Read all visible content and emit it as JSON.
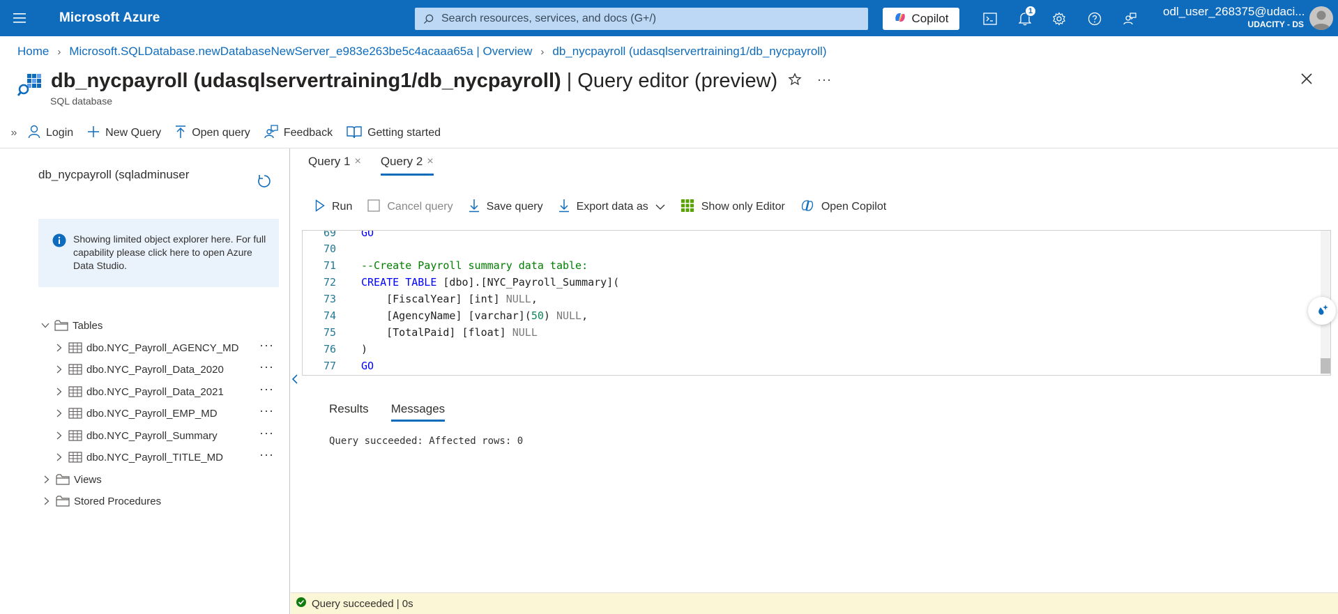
{
  "topbar": {
    "brand": "Microsoft Azure",
    "search_placeholder": "Search resources, services, and docs (G+/)",
    "copilot_label": "Copilot",
    "notification_count": "1",
    "account_name": "odl_user_268375@udaci...",
    "account_directory": "UDACITY - DS"
  },
  "breadcrumb": {
    "items": [
      "Home",
      "Microsoft.SQLDatabase.newDatabaseNewServer_e983e263be5c4acaaa65a | Overview",
      "db_nycpayroll (udasqlservertraining1/db_nycpayroll)"
    ]
  },
  "page": {
    "title_bold": "db_nycpayroll (udasqlservertraining1/db_nycpayroll)",
    "title_rest": " | Query editor (preview)",
    "subtitle": "SQL database"
  },
  "commands": {
    "login": "Login",
    "new_query": "New Query",
    "open_query": "Open query",
    "feedback": "Feedback",
    "getting_started": "Getting started"
  },
  "explorer": {
    "db_label": "db_nycpayroll (sqladminuser",
    "info_text": "Showing limited object explorer here. For full capability please click here to open Azure Data Studio.",
    "tables_label": "Tables",
    "tables": [
      "dbo.NYC_Payroll_AGENCY_MD",
      "dbo.NYC_Payroll_Data_2020",
      "dbo.NYC_Payroll_Data_2021",
      "dbo.NYC_Payroll_EMP_MD",
      "dbo.NYC_Payroll_Summary",
      "dbo.NYC_Payroll_TITLE_MD"
    ],
    "views_label": "Views",
    "procedures_label": "Stored Procedures"
  },
  "query_tabs": [
    "Query 1",
    "Query 2"
  ],
  "editor_toolbar": {
    "run": "Run",
    "cancel": "Cancel query",
    "save": "Save query",
    "export": "Export data as",
    "show_only_editor": "Show only Editor",
    "open_copilot": "Open Copilot"
  },
  "editor": {
    "lines": [
      {
        "n": "69",
        "text": "GO"
      },
      {
        "n": "70",
        "text": ""
      },
      {
        "n": "71",
        "text": "--Create Payroll summary data table:"
      },
      {
        "n": "72",
        "text": "CREATE TABLE [dbo].[NYC_Payroll_Summary]("
      },
      {
        "n": "73",
        "text": "    [FiscalYear] [int] NULL,"
      },
      {
        "n": "74",
        "text": "    [AgencyName] [varchar](50) NULL,"
      },
      {
        "n": "75",
        "text": "    [TotalPaid] [float] NULL"
      },
      {
        "n": "76",
        "text": ")"
      },
      {
        "n": "77",
        "text": "GO"
      }
    ]
  },
  "results": {
    "tabs": [
      "Results",
      "Messages"
    ],
    "message": "Query succeeded: Affected rows: 0"
  },
  "status": {
    "text": "Query succeeded | 0s"
  }
}
